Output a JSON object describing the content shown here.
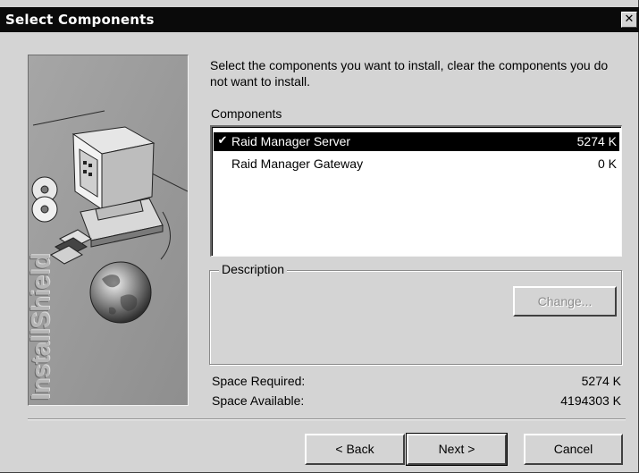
{
  "window": {
    "title": "Select Components",
    "close_glyph": "✕"
  },
  "banner": {
    "brand_text": "InstallShield",
    "icons": [
      "computer-icon",
      "cd-discs-icon",
      "floppy-disks-icon",
      "globe-icon"
    ]
  },
  "main": {
    "instruction": "Select the components you want to install, clear the components you do not want to install.",
    "components_label": "Components",
    "components": [
      {
        "checked": true,
        "check_glyph": "✔",
        "name": "Raid Manager Server",
        "size": "5274 K",
        "selected": true
      },
      {
        "checked": false,
        "check_glyph": "",
        "name": "Raid Manager Gateway",
        "size": "0 K",
        "selected": false
      }
    ],
    "description_label": "Description",
    "description_text": "",
    "change_button": "Change...",
    "space_required_label": "Space Required:",
    "space_required_value": "5274 K",
    "space_available_label": "Space Available:",
    "space_available_value": "4194303 K"
  },
  "buttons": {
    "back": "< Back",
    "next": "Next >",
    "cancel": "Cancel"
  },
  "colors": {
    "title_bar": "#0a0a0a",
    "dialog_face": "#d4d4d4",
    "selection": "#000000"
  }
}
